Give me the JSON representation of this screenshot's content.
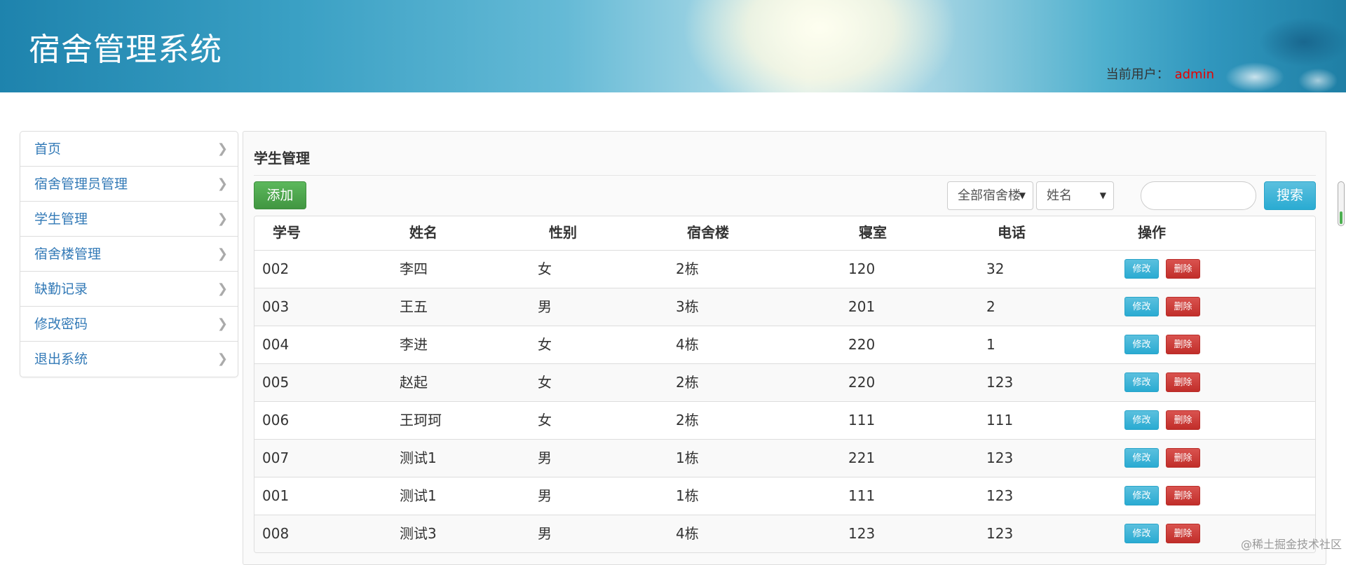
{
  "header": {
    "title": "宿舍管理系统",
    "user_label": "当前用户：",
    "user_name": "admin"
  },
  "sidebar": {
    "items": [
      {
        "label": "首页"
      },
      {
        "label": "宿舍管理员管理"
      },
      {
        "label": "学生管理"
      },
      {
        "label": "宿舍楼管理"
      },
      {
        "label": "缺勤记录"
      },
      {
        "label": "修改密码"
      },
      {
        "label": "退出系统"
      }
    ]
  },
  "main": {
    "title": "学生管理",
    "add_label": "添加",
    "building_select": "全部宿舍楼",
    "field_select": "姓名",
    "search_value": "",
    "search_label": "搜索",
    "columns": [
      "学号",
      "姓名",
      "性别",
      "宿舍楼",
      "寝室",
      "电话",
      "操作"
    ],
    "edit_label": "修改",
    "delete_label": "删除",
    "rows": [
      [
        "002",
        "李四",
        "女",
        "2栋",
        "120",
        "32"
      ],
      [
        "003",
        "王五",
        "男",
        "3栋",
        "201",
        "2"
      ],
      [
        "004",
        "李进",
        "女",
        "4栋",
        "220",
        "1"
      ],
      [
        "005",
        "赵起",
        "女",
        "2栋",
        "220",
        "123"
      ],
      [
        "006",
        "王珂珂",
        "女",
        "2栋",
        "111",
        "111"
      ],
      [
        "007",
        "测试1",
        "男",
        "1栋",
        "221",
        "123"
      ],
      [
        "001",
        "测试1",
        "男",
        "1栋",
        "111",
        "123"
      ],
      [
        "008",
        "测试3",
        "男",
        "4栋",
        "123",
        "123"
      ]
    ]
  },
  "watermark": "@稀土掘金技术社区",
  "colors": {
    "accent_link": "#337ab7",
    "add_green": "#5cb85c",
    "search_blue": "#5bc0de",
    "delete_red": "#d9534f",
    "user_red": "#e60000"
  }
}
